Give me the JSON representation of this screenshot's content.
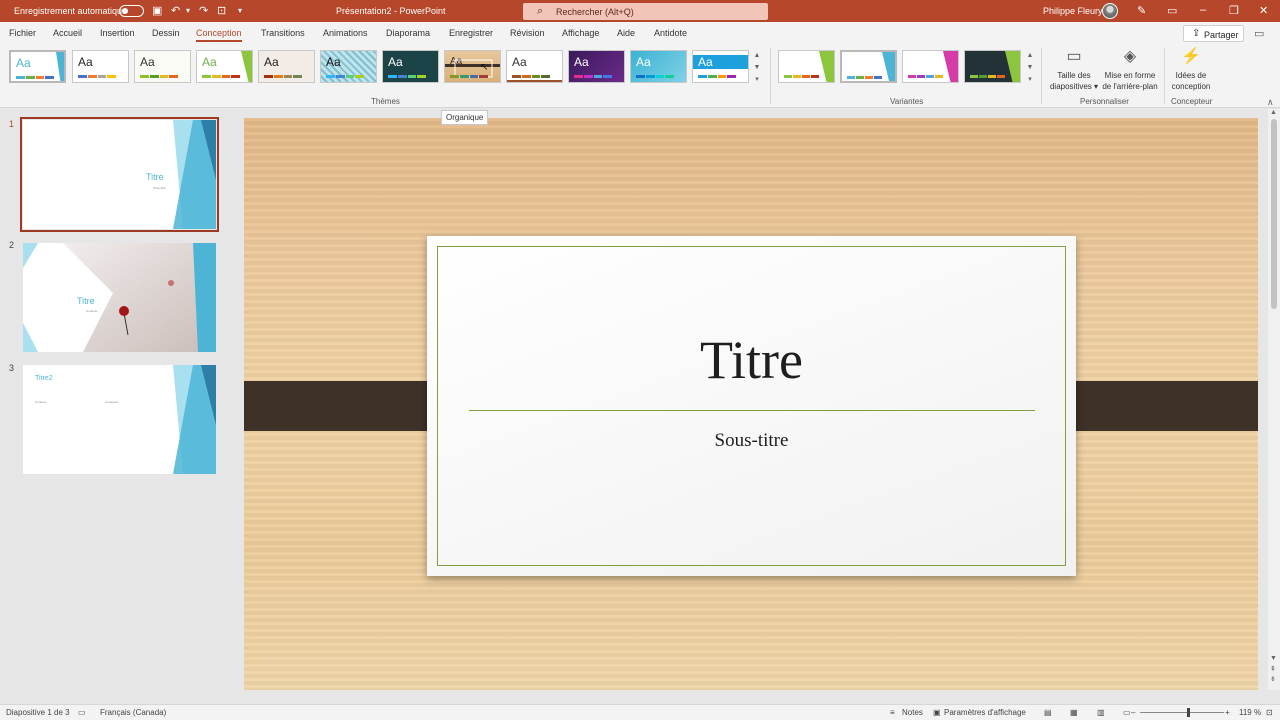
{
  "titlebar": {
    "autosave_label": "Enregistrement automatique",
    "document_title": "Présentation2 - PowerPoint",
    "search_placeholder": "Rechercher (Alt+Q)",
    "user_name": "Philippe Fleury"
  },
  "tabs": [
    "Fichier",
    "Accueil",
    "Insertion",
    "Dessin",
    "Conception",
    "Transitions",
    "Animations",
    "Diaporama",
    "Enregistrer",
    "Révision",
    "Affichage",
    "Aide",
    "Antidote"
  ],
  "active_tab": "Conception",
  "share_label": "Partager",
  "ribbon": {
    "themes_group_label": "Thèmes",
    "variants_group_label": "Variantes",
    "customize_group_label": "Personnaliser",
    "designer_group_label": "Concepteur",
    "theme_sample_text": "Aa",
    "slide_size_label_1": "Taille des",
    "slide_size_label_2": "diapositives",
    "bg_format_label_1": "Mise en forme",
    "bg_format_label_2": "de l'arrière-plan",
    "design_ideas_label_1": "Idées de",
    "design_ideas_label_2": "conception"
  },
  "tooltip": "Organique",
  "thumbnails": [
    {
      "number": "1",
      "title": "Titre",
      "subtitle": "Sous-titre"
    },
    {
      "number": "2",
      "title": "Titre",
      "subtitle": "Contenu"
    },
    {
      "number": "3",
      "title": "Titre2",
      "bullet1": "Contenu",
      "bullet2": "Contenu2"
    }
  ],
  "slide": {
    "title": "Titre",
    "subtitle": "Sous-titre"
  },
  "statusbar": {
    "slide_count": "Diapositive 1 de 3",
    "language": "Français (Canada)",
    "notes": "Notes",
    "display_settings": "Paramètres d'affichage",
    "zoom": "119 %"
  },
  "colors": {
    "accent": "#b7472a",
    "theme_green": "#7da046",
    "strap": "#3e3128"
  }
}
